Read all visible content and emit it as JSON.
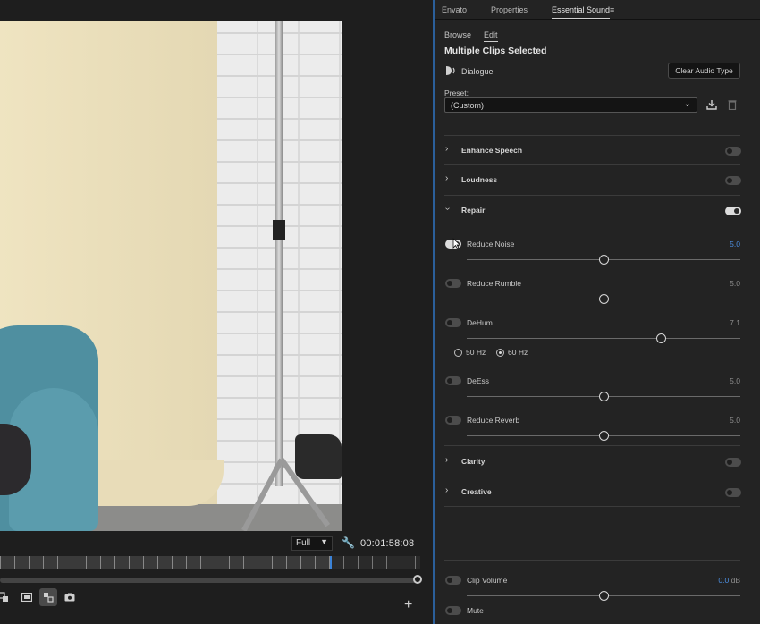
{
  "monitor": {
    "zoom_level": "Full",
    "timecode": "00:01:58:08",
    "add_button": "+",
    "transport_icons": [
      "export-frame-icon",
      "safe-margins-icon",
      "compare-view-icon",
      "camera-icon"
    ]
  },
  "panel": {
    "tabs": [
      {
        "label": "Envato"
      },
      {
        "label": "Properties"
      },
      {
        "label": "Essential Sound"
      }
    ],
    "menu_glyph": "≡",
    "subtabs": [
      {
        "label": "Browse"
      },
      {
        "label": "Edit"
      }
    ],
    "clips_title": "Multiple Clips Selected",
    "audio_type": "Dialogue",
    "clear_button": "Clear Audio Type",
    "preset_label": "Preset:",
    "preset_value": "(Custom)",
    "sections": {
      "enhance_speech": {
        "title": "Enhance Speech",
        "enabled": false
      },
      "loudness": {
        "title": "Loudness",
        "enabled": false
      },
      "repair": {
        "title": "Repair",
        "enabled": true
      },
      "clarity": {
        "title": "Clarity",
        "enabled": false
      },
      "creative": {
        "title": "Creative",
        "enabled": false
      }
    },
    "params": {
      "reduce_noise": {
        "label": "Reduce Noise",
        "value": "5.0",
        "enabled": true,
        "level": 0.5
      },
      "reduce_rumble": {
        "label": "Reduce Rumble",
        "value": "5.0",
        "enabled": false,
        "level": 0.5
      },
      "dehum": {
        "label": "DeHum",
        "value": "7.1",
        "enabled": false,
        "level": 0.71
      },
      "deess": {
        "label": "DeEss",
        "value": "5.0",
        "enabled": false,
        "level": 0.5
      },
      "reduce_reverb": {
        "label": "Reduce Reverb",
        "value": "5.0",
        "enabled": false,
        "level": 0.5
      },
      "clip_volume": {
        "label": "Clip Volume",
        "value": "0.0",
        "unit": "dB",
        "enabled": false,
        "level": 0.5
      }
    },
    "dehum_options": [
      {
        "label": "50 Hz",
        "selected": false
      },
      {
        "label": "60 Hz",
        "selected": true
      }
    ],
    "mute": {
      "label": "Mute",
      "enabled": false
    },
    "colors": {
      "accent": "#4d8fe0",
      "panel_border": "#2b5f9a"
    }
  }
}
